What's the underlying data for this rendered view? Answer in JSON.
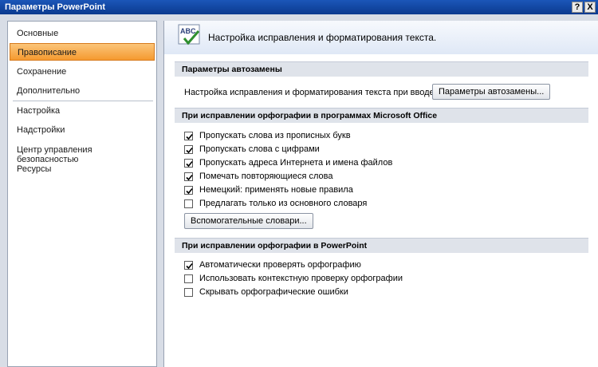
{
  "window": {
    "title": "Параметры PowerPoint",
    "help_label": "?",
    "close_label": "X"
  },
  "sidebar": {
    "items": [
      {
        "label": "Основные"
      },
      {
        "label": "Правописание",
        "active": true
      },
      {
        "label": "Сохранение"
      },
      {
        "label": "Дополнительно"
      },
      {
        "label": "Настройка"
      },
      {
        "label": "Надстройки"
      },
      {
        "label": "Центр управления безопасностью"
      },
      {
        "label": "Ресурсы"
      }
    ]
  },
  "main": {
    "header_icon": "abc-spelling-icon",
    "header_icon_text": "ABC",
    "header_text": "Настройка исправления и форматирования текста.",
    "autocorrect": {
      "section_title": "Параметры автозамены",
      "label": "Настройка исправления и форматирования текста при вводе:",
      "button_label": "Параметры автозамены..."
    },
    "office_spelling": {
      "section_title": "При исправлении орфографии в программах Microsoft Office",
      "options": [
        {
          "label": "Пропускать слова из прописных букв",
          "checked": true
        },
        {
          "label": "Пропускать слова с цифрами",
          "checked": true
        },
        {
          "label": "Пропускать адреса Интернета и имена файлов",
          "checked": true
        },
        {
          "label": "Помечать повторяющиеся слова",
          "checked": true
        },
        {
          "label": "Немецкий: применять новые правила",
          "checked": true
        },
        {
          "label": "Предлагать только из основного словаря",
          "checked": false
        }
      ],
      "button_label": "Вспомогательные словари..."
    },
    "ppt_spelling": {
      "section_title": "При исправлении орфографии в PowerPoint",
      "options": [
        {
          "label": "Автоматически проверять орфографию",
          "checked": true
        },
        {
          "label": "Использовать контекстную проверку орфографии",
          "checked": false
        },
        {
          "label": "Скрывать орфографические ошибки",
          "checked": false
        }
      ]
    }
  },
  "colors": {
    "title_bar": "#0b3a8f",
    "active_item": "#f59a2f",
    "section_band": "#dfe3ea"
  }
}
